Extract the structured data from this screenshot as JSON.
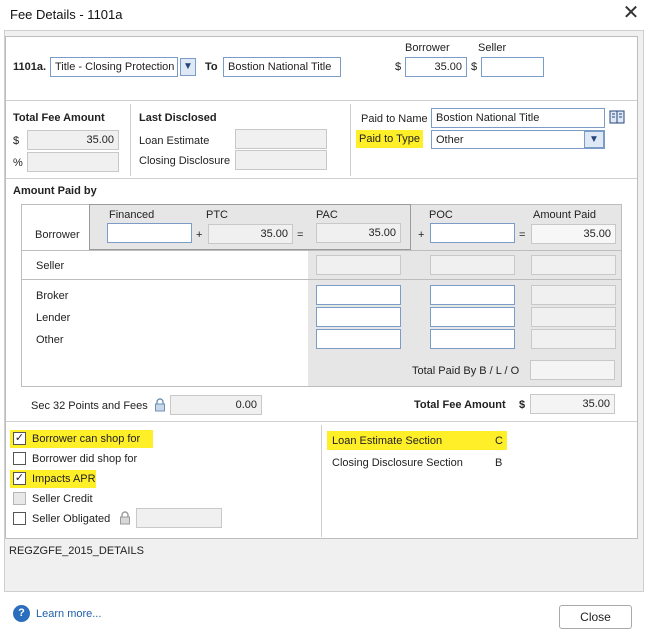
{
  "window": {
    "title": "Fee Details - 1101a"
  },
  "header": {
    "line_label": "1101a.",
    "fee_type_value": "Title - Closing Protection L",
    "to_label": "To",
    "to_value": "Bostion National Title",
    "borrower_col": "Borrower",
    "seller_col": "Seller",
    "dollar": "$",
    "borrower_amount": "35.00",
    "seller_amount": ""
  },
  "total_fee": {
    "title": "Total Fee Amount",
    "dollar": "$",
    "amount": "35.00",
    "pct_label": "%",
    "pct_value": ""
  },
  "last_disclosed": {
    "title": "Last Disclosed",
    "loan_estimate_label": "Loan Estimate",
    "closing_disclosure_label": "Closing Disclosure"
  },
  "paid_to": {
    "name_label": "Paid to Name",
    "name_value": "Bostion National Title",
    "type_label": "Paid to Type",
    "type_value": "Other"
  },
  "amount_paid_by": {
    "title": "Amount Paid by",
    "headers": {
      "financed": "Financed",
      "ptc": "PTC",
      "pac": "PAC",
      "poc": "POC",
      "amount_paid": "Amount Paid"
    },
    "borrower": {
      "label": "Borrower",
      "financed": "",
      "ptc": "35.00",
      "pac": "35.00",
      "poc": "",
      "amount_paid": "35.00"
    },
    "plus": "+",
    "equals": "=",
    "seller_label": "Seller",
    "others": [
      "Broker",
      "Lender",
      "Other"
    ],
    "total_paid_label": "Total Paid By B / L / O"
  },
  "sec32": {
    "label": "Sec 32 Points and Fees",
    "value": "0.00"
  },
  "total_fee_bottom": {
    "label": "Total Fee Amount",
    "dollar": "$",
    "value": "35.00"
  },
  "checkboxes": [
    {
      "label": "Borrower can shop for",
      "checked": true,
      "highlight": true
    },
    {
      "label": "Borrower did shop for",
      "checked": false,
      "highlight": false
    },
    {
      "label": "Impacts APR",
      "checked": true,
      "highlight": true
    },
    {
      "label": "Seller Credit",
      "checked": false,
      "highlight": false,
      "disabled": true
    },
    {
      "label": "Seller Obligated",
      "checked": false,
      "highlight": false
    }
  ],
  "sections": {
    "loan_estimate_label": "Loan Estimate Section",
    "loan_estimate_value": "C",
    "closing_disclosure_label": "Closing Disclosure Section",
    "closing_disclosure_value": "B"
  },
  "form_id": "REGZGFE_2015_DETAILS",
  "footer": {
    "learn_more": "Learn more...",
    "close": "Close"
  },
  "colors": {
    "highlight": "#ffef29",
    "input_border": "#7a9cc6",
    "link": "#1f5fa8"
  }
}
